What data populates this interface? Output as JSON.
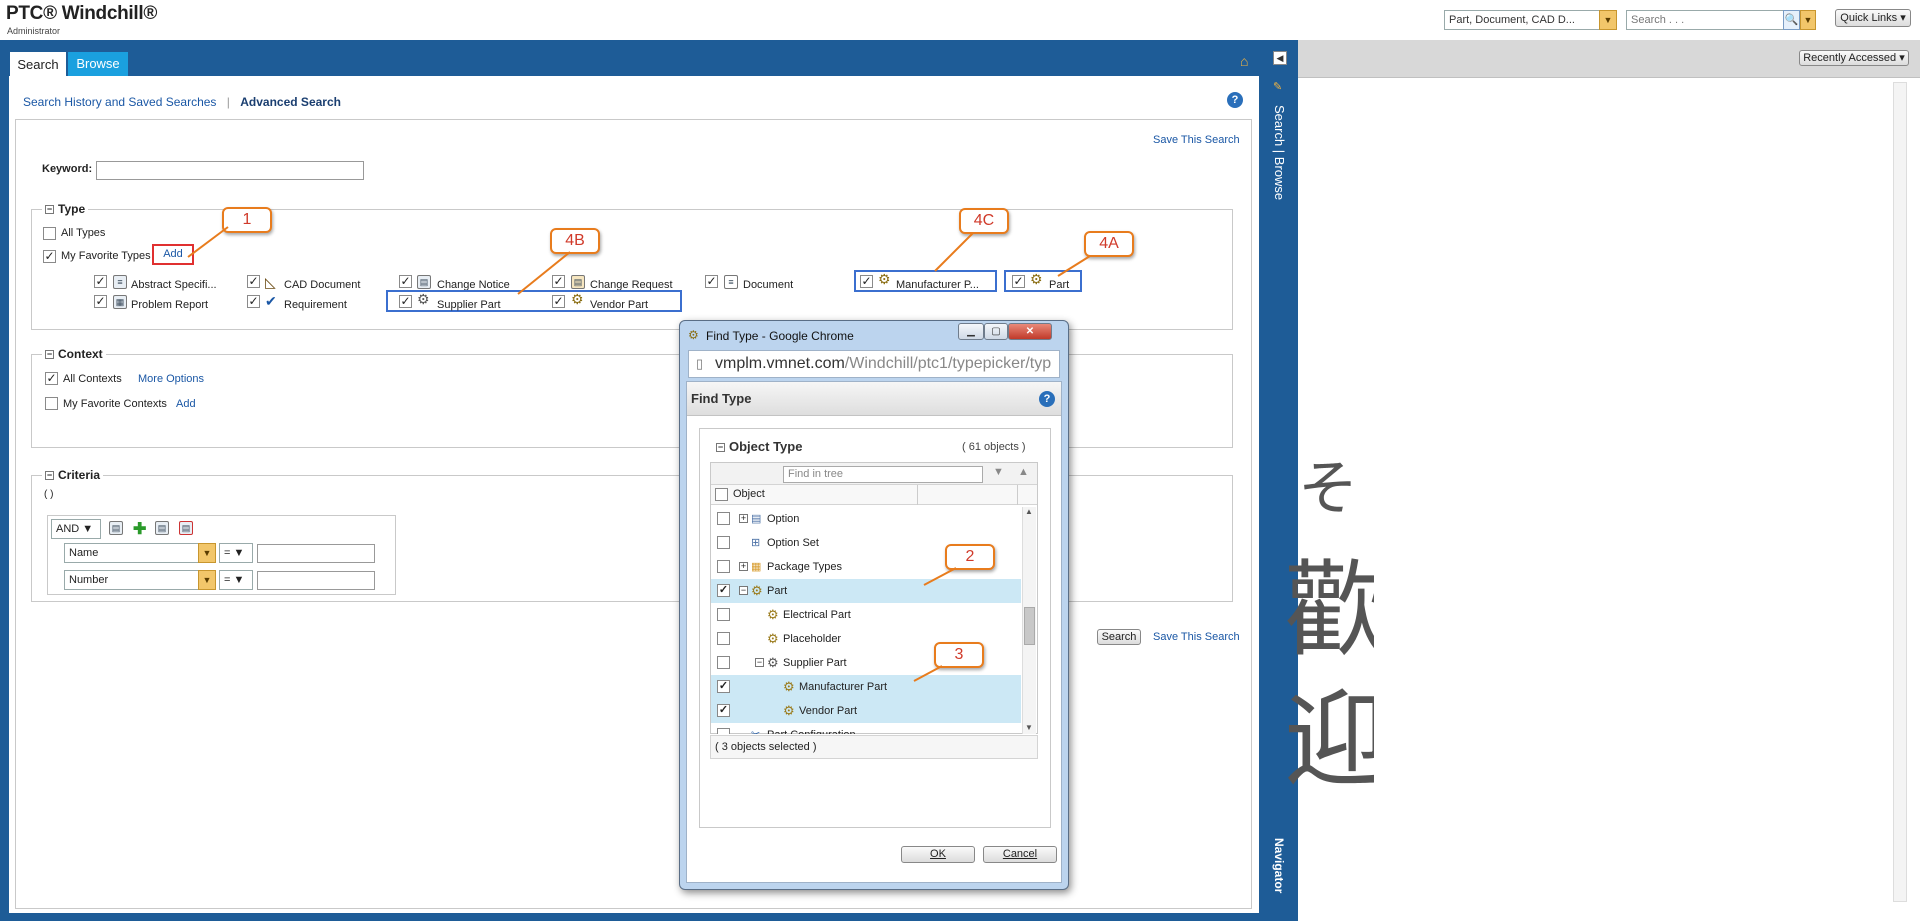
{
  "header": {
    "logo": "PTC® Windchill®",
    "role": "Administrator",
    "type_filter": "Part, Document, CAD D...",
    "search_placeholder": "Search . . .",
    "quick_links": "Quick Links"
  },
  "tabs": {
    "search": "Search",
    "browse": "Browse"
  },
  "subnav": {
    "history": "Search History and Saved Searches",
    "advanced": "Advanced Search"
  },
  "save_search": "Save This Search",
  "keyword_label": "Keyword:",
  "type_section": {
    "title": "Type",
    "all_types": "All Types",
    "favorite_types": "My Favorite Types",
    "add": "Add",
    "types": [
      "Abstract Specifi...",
      "CAD Document",
      "Change Notice",
      "Change Request",
      "Document",
      "Manufacturer P...",
      "Part",
      "Problem Report",
      "Requirement",
      "Supplier Part",
      "Vendor Part"
    ]
  },
  "context_section": {
    "title": "Context",
    "all_contexts": "All Contexts",
    "more_options": "More Options",
    "favorite_contexts": "My Favorite Contexts",
    "add": "Add"
  },
  "criteria_section": {
    "title": "Criteria",
    "expr": "( )",
    "operator": "AND",
    "rows": [
      {
        "attribute": "Name",
        "op": "="
      },
      {
        "attribute": "Number",
        "op": "="
      }
    ]
  },
  "search_button": "Search",
  "callouts": {
    "c1": "1",
    "c2": "2",
    "c3": "3",
    "c4a": "4A",
    "c4b": "4B",
    "c4c": "4C"
  },
  "side_nav": {
    "search_browse": "Search | Browse",
    "navigator": "Navigator"
  },
  "right_pane": {
    "recently_accessed": "Recently Accessed",
    "char1": "そ",
    "char2": "歡",
    "char3": "迎"
  },
  "dialog": {
    "window_title": "Find Type - Google Chrome",
    "url_host": "vmplm.vmnet.com",
    "url_path": "/Windchill/ptc1/typepicker/typ",
    "heading": "Find Type",
    "object_type": "Object Type",
    "count": "( 61 objects )",
    "find_placeholder": "Find in tree",
    "column": "Object",
    "rows": [
      "Option",
      "Option Set",
      "Package Types",
      "Part",
      "Electrical Part",
      "Placeholder",
      "Supplier Part",
      "Manufacturer Part",
      "Vendor Part",
      "Part Configuration"
    ],
    "selected": "( 3 objects selected )",
    "ok": "OK",
    "cancel": "Cancel"
  },
  "colors": {
    "frame_blue": "#1e5c97",
    "tab_blue": "#1aa0df",
    "callout_orange": "#e87c1d",
    "highlight": "#cce8f5"
  }
}
